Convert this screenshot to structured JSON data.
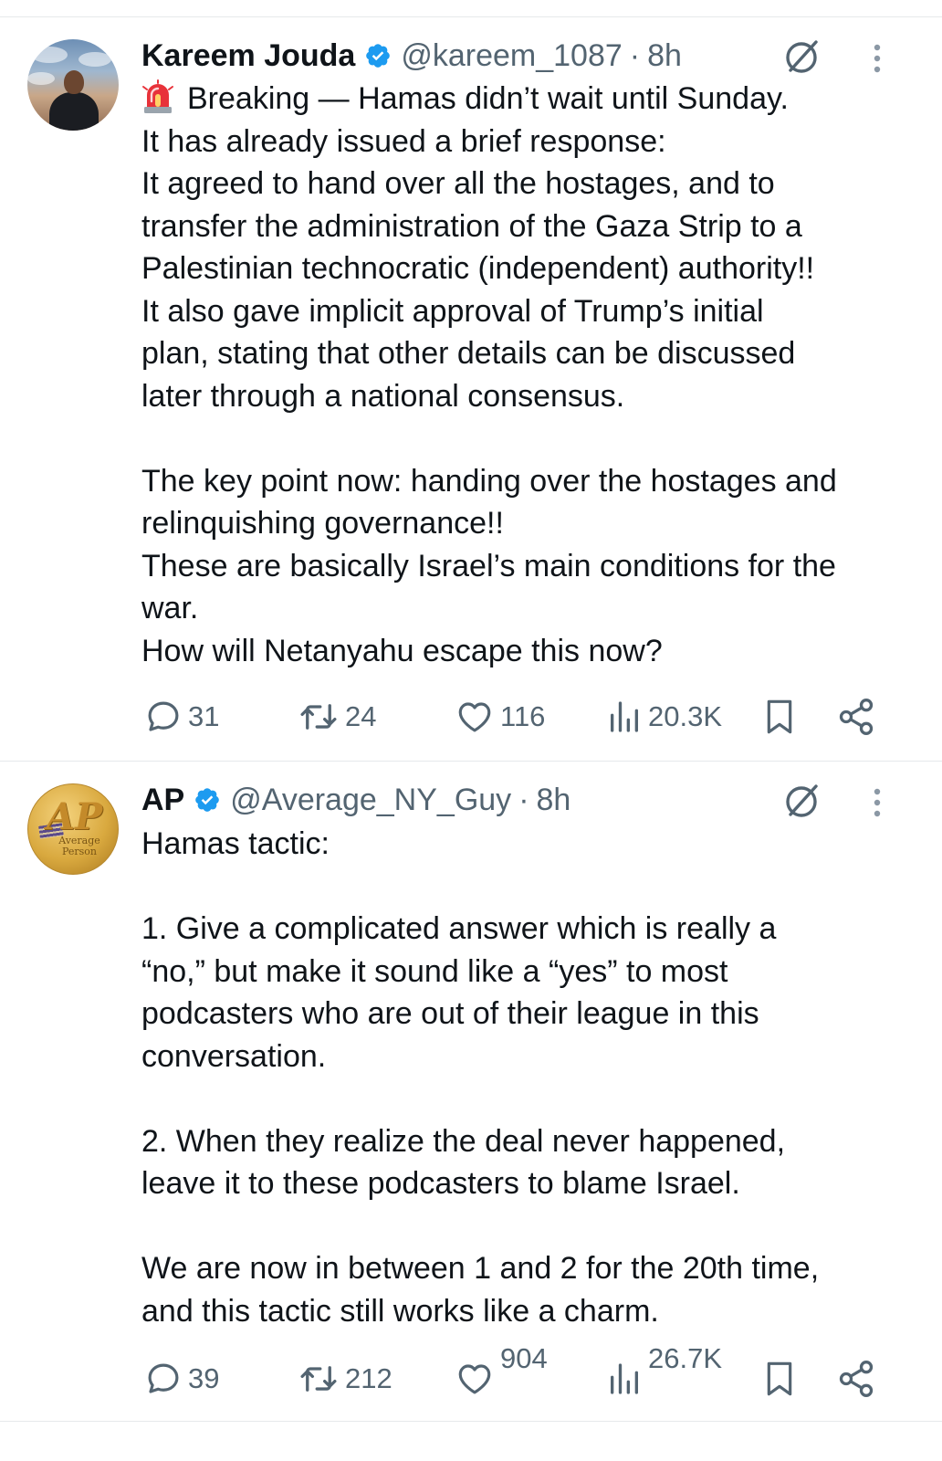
{
  "tweets": [
    {
      "author": {
        "name": "Kareem Jouda",
        "handle": "@kareem_1087",
        "verified": true
      },
      "separator": "·",
      "time": "8h",
      "emoji": "siren",
      "text_lines": [
        "Breaking — Hamas didn’t wait until Sunday.",
        "It has already issued a brief response:",
        "It agreed to hand over all the hostages, and to",
        "transfer the administration of the Gaza Strip to a",
        "Palestinian technocratic (independent) authority!!",
        "It also gave implicit approval of Trump’s initial",
        "plan, stating that other details can be discussed",
        "later through a national consensus.",
        "",
        "The key point now: handing over the hostages and",
        "relinquishing governance!!",
        "These are basically Israel’s main conditions for the",
        "war.",
        "How will Netanyahu escape this now?"
      ],
      "stats": {
        "replies": "31",
        "reposts": "24",
        "likes": "116",
        "views": "20.3K"
      }
    },
    {
      "author": {
        "name": "AP",
        "handle": "@Average_NY_Guy",
        "verified": true,
        "avatar_text": "AP",
        "avatar_caption": "Average Person"
      },
      "separator": "·",
      "time": "8h",
      "text_lines": [
        "Hamas tactic:",
        "",
        "1. Give a complicated answer which is really a",
        "“no,” but make it sound like a “yes” to most",
        "podcasters who are out of their league in this",
        "conversation.",
        "",
        "2. When they realize the deal never happened,",
        "leave it to these podcasters to blame Israel.",
        "",
        "We are now in between 1 and 2 for the 20th time,",
        "and this tactic still works like a charm."
      ],
      "stats": {
        "replies": "39",
        "reposts": "212",
        "likes": "904",
        "views": "26.7K"
      }
    }
  ],
  "colors": {
    "text": "#0f1419",
    "secondary": "#536471",
    "verified": "#1d9bf0",
    "divider": "#e6e9eb"
  },
  "icons": {
    "reply": "speech-bubble-icon",
    "repost": "repost-arrows-icon",
    "like": "heart-icon",
    "views": "bar-chart-icon",
    "bookmark": "bookmark-icon",
    "share": "share-icon",
    "grok": "grok-slash-circle-icon",
    "more": "vertical-ellipsis-icon"
  }
}
